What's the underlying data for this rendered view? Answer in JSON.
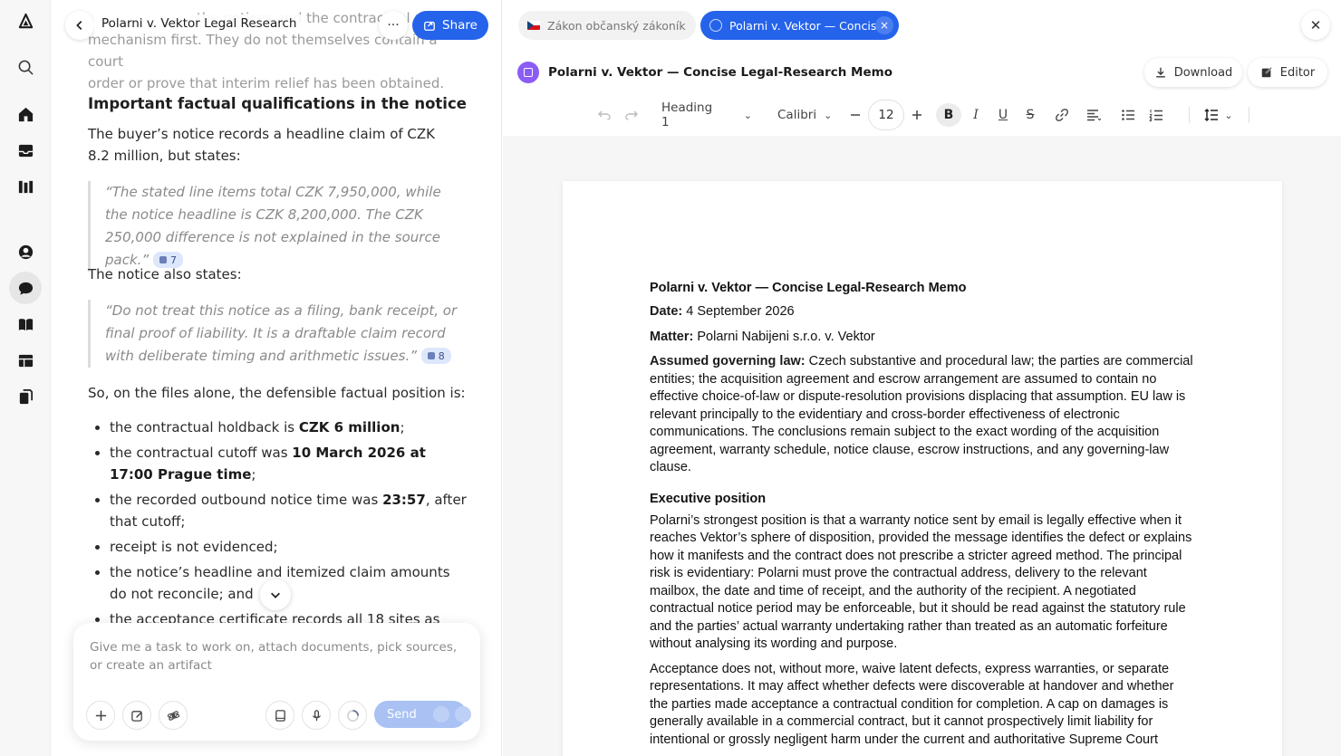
{
  "rail": {
    "items": [
      {
        "name": "logo-icon"
      },
      {
        "name": "search-icon"
      },
      {
        "name": "home-icon"
      },
      {
        "name": "inbox-icon"
      },
      {
        "name": "library-icon"
      },
      {
        "name": "profile-icon"
      },
      {
        "name": "chat-icon"
      },
      {
        "name": "book-icon"
      },
      {
        "name": "table-icon"
      },
      {
        "name": "documents-icon"
      }
    ]
  },
  "chat": {
    "title": "Polarni v. Vektor Legal Research",
    "share_label": "Share",
    "more_label": "···",
    "faded_intro_1": "the notices and the contractual notice",
    "faded_intro_2": "mechanism first. They do not themselves contain a court",
    "faded_intro_3": "order or prove that interim relief has been obtained.",
    "heading": "Important factual qualifications in the notice",
    "para1": "The buyer’s notice records a headline claim of CZK 8.2 million, but states:",
    "quote1": "“The stated line items total CZK 7,950,000, while the notice headline is CZK 8,200,000. The CZK 250,000 difference is not explained in the source pack.”",
    "cite1": "7",
    "para2": "The notice also states:",
    "quote2": "“Do not treat this notice as a filing, bank receipt, or final proof of liability. It is a draftable claim record with deliberate timing and arithmetic issues.”",
    "cite2": "8",
    "para3": "So, on the files alone, the defensible factual position is:",
    "bullets": {
      "b1_pre": "the contractual holdback is ",
      "b1_bold": "CZK 6 million",
      "b1_post": ";",
      "b2_pre": "the contractual cutoff was ",
      "b2_bold": "10 March 2026 at 17:00 Prague time",
      "b2_post": ";",
      "b3_pre": "the recorded outbound notice time was ",
      "b3_bold": "23:57",
      "b3_post": ", after that cutoff;",
      "b4": "receipt is not evidenced;",
      "b5": "the notice’s headline and itemized claim amounts do not reconcile; and",
      "b6": "the acceptance certificate records all 18 sites as"
    },
    "composer": {
      "placeholder": "Give me a task to work on, attach documents, pick sources, or create an artifact",
      "send_label": "Send"
    }
  },
  "doc": {
    "tabs": [
      {
        "label": "Zákon občanský zákoník"
      },
      {
        "label": "Polarni v. Vektor — Concis..."
      }
    ],
    "title": "Polarni v. Vektor — Concise Legal-Research Memo",
    "download_label": "Download",
    "editor_label": "Editor",
    "toolbar": {
      "style": "Heading 1",
      "font": "Calibri",
      "size": "12"
    },
    "page": {
      "heading": "Polarni v. Vektor — Concise Legal-Research Memo",
      "date_label": "Date:",
      "date_value": " 4 September 2026",
      "matter_label": "Matter:",
      "matter_value": " Polarni Nabijeni s.r.o. v. Vektor",
      "law_label": "Assumed governing law:",
      "law_value": " Czech substantive and procedural law; the parties are commercial entities; the acquisition agreement and escrow arrangement are assumed to contain no effective choice-of-law or dispute-resolution provisions displacing that assumption. EU law is relevant principally to the evidentiary and cross-border effectiveness of electronic communications. The conclusions remain subject to the exact wording of the acquisition agreement, warranty schedule, notice clause, escrow instructions, and any governing-law clause.",
      "exec_heading": "Executive position",
      "exec_p1": "Polarni’s strongest position is that a warranty notice sent by email is legally effective when it reaches Vektor’s sphere of disposition, provided the message identifies the defect or explains how it manifests and the contract does not prescribe a stricter agreed method. The principal risk is evidentiary: Polarni must prove the contractual address, delivery to the relevant mailbox, the date and time of receipt, and the authority of the recipient. A negotiated contractual notice period may be enforceable, but it should be read against the statutory rule and the parties’ actual warranty undertaking rather than treated as an automatic forfeiture without analysing its wording and purpose.",
      "exec_p2": "Acceptance does not, without more, waive latent defects, express warranties, or separate representations. It may affect whether defects were discoverable at handover and whether the parties made acceptance a contractual condition for completion. A cap on damages is generally available in a commercial contract, but it cannot prospectively limit liability for intentional or grossly negligent harm under the current and authoritative Supreme Court"
    }
  }
}
